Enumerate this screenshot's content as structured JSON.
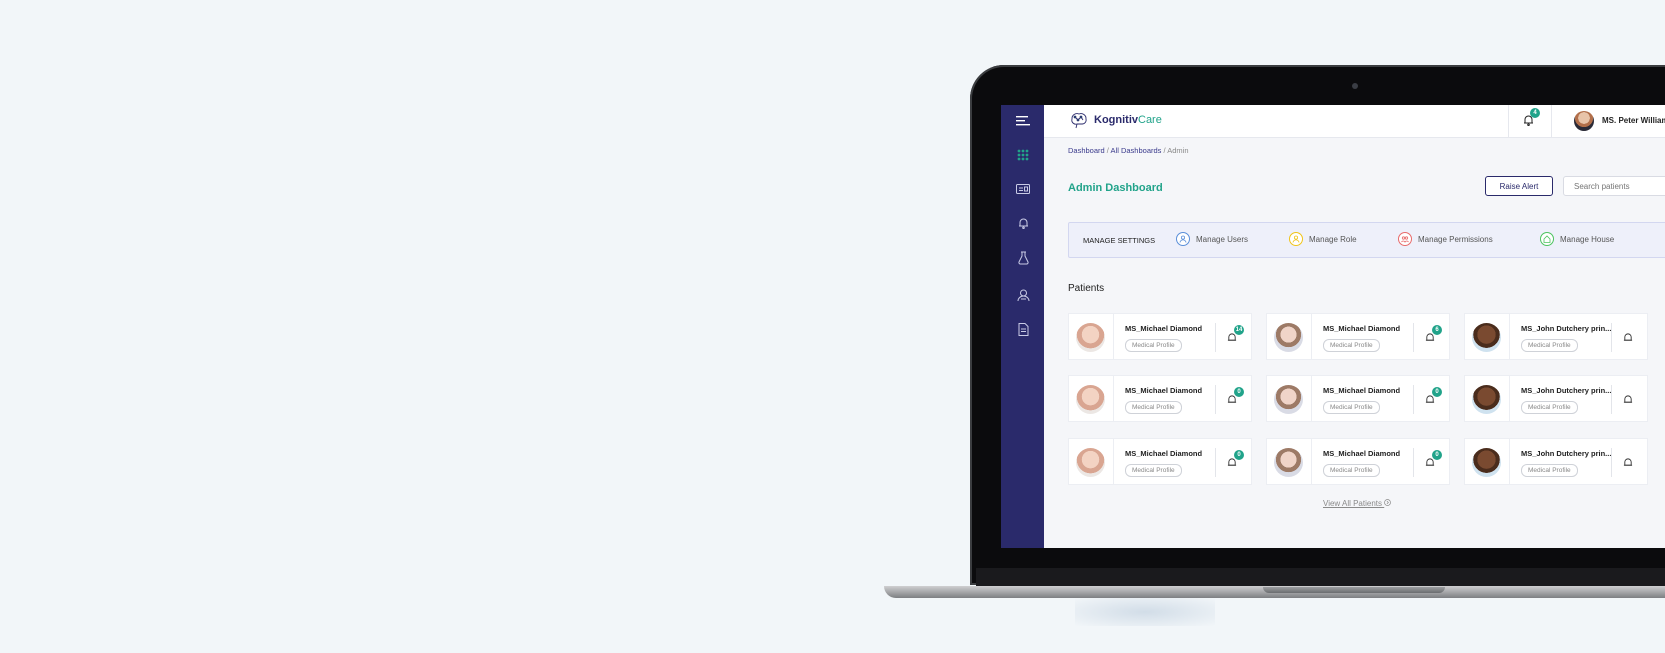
{
  "colors": {
    "sidebar": "#2a2a6b",
    "accent": "#21a38a",
    "primary": "#2a2a6b"
  },
  "sidebar": {
    "icons": [
      "menu-icon",
      "dashboard-grid-icon",
      "id-card-icon",
      "bell-icon",
      "lab-flask-icon",
      "caregiver-icon",
      "document-icon"
    ]
  },
  "header": {
    "logo_part1": "Kognitiv",
    "logo_part2": "Care",
    "notification_count": "4",
    "user_name": "MS. Peter Williams"
  },
  "breadcrumb": {
    "dashboard": "Dashboard",
    "all_dashboards": "All Dashboards",
    "current": "Admin",
    "separator": " / "
  },
  "page": {
    "title": "Admin Dashboard",
    "raise_alert": "Raise Alert",
    "search_placeholder": "Search patients"
  },
  "settings": {
    "label": "MANAGE SETTINGS",
    "items": [
      {
        "label": "Manage Users",
        "icon": "user-icon",
        "color": "#5b8fd9"
      },
      {
        "label": "Manage Role",
        "icon": "role-icon",
        "color": "#f0c419"
      },
      {
        "label": "Manage Permissions",
        "icon": "permissions-icon",
        "color": "#e86b6b"
      },
      {
        "label": "Manage House",
        "icon": "house-icon",
        "color": "#4cc35f"
      }
    ]
  },
  "patients": {
    "title": "Patients",
    "view_all": "View All Patients",
    "cards": [
      {
        "name": "MS_Michael Diamond",
        "tag": "Medical Profile",
        "alerts": "14"
      },
      {
        "name": "MS_Michael Diamond",
        "tag": "Medical Profile",
        "alerts": "6"
      },
      {
        "name": "MS_John Dutchery prin...",
        "tag": "Medical Profile",
        "alerts": ""
      },
      {
        "name": "MS_Michael Diamond",
        "tag": "Medical Profile",
        "alerts": "0"
      },
      {
        "name": "MS_Michael Diamond",
        "tag": "Medical Profile",
        "alerts": "0"
      },
      {
        "name": "MS_John Dutchery prin...",
        "tag": "Medical Profile",
        "alerts": ""
      },
      {
        "name": "MS_Michael Diamond",
        "tag": "Medical Profile",
        "alerts": "0"
      },
      {
        "name": "MS_Michael Diamond",
        "tag": "Medical Profile",
        "alerts": "0"
      },
      {
        "name": "MS_John Dutchery prin...",
        "tag": "Medical Profile",
        "alerts": ""
      }
    ]
  }
}
